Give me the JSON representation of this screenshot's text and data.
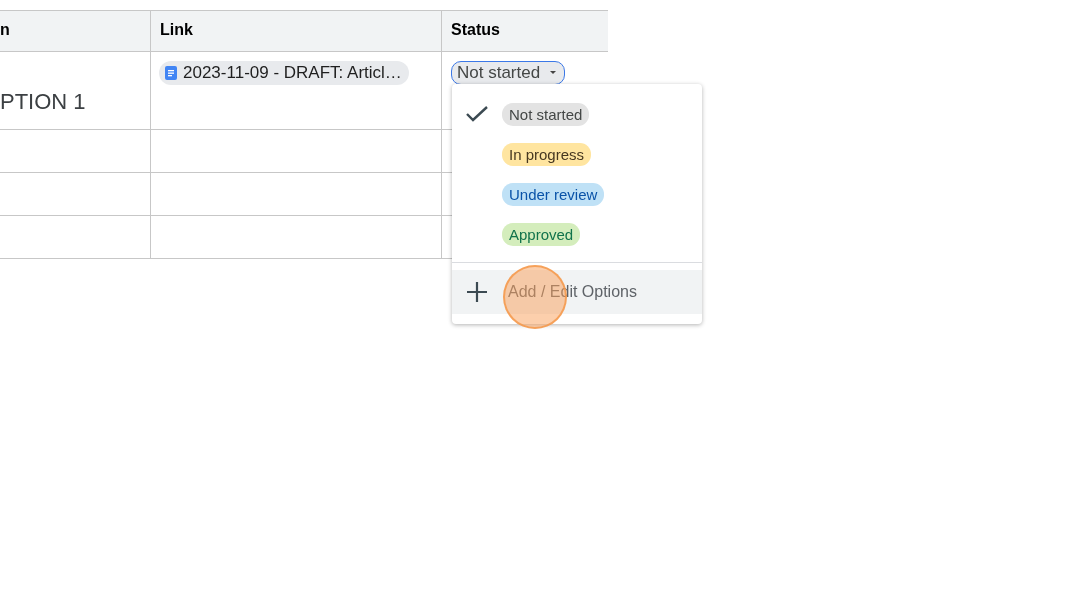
{
  "table": {
    "columns": [
      "n",
      "Link",
      "Status"
    ],
    "rows": [
      {
        "column_1": "PTION 1",
        "link": "2023-11-09 - DRAFT: Articl…",
        "status": "Not started"
      },
      {},
      {},
      {}
    ]
  },
  "status_menu": {
    "options": [
      {
        "label": "Not started",
        "selected": true,
        "color": "#e3e3e3"
      },
      {
        "label": "In progress",
        "selected": false,
        "color": "#ffe5a0"
      },
      {
        "label": "Under review",
        "selected": false,
        "color": "#bfe1f6"
      },
      {
        "label": "Approved",
        "selected": false,
        "color": "#d4edbc"
      }
    ],
    "action": "Add / Edit Options"
  },
  "click_indicator": true
}
